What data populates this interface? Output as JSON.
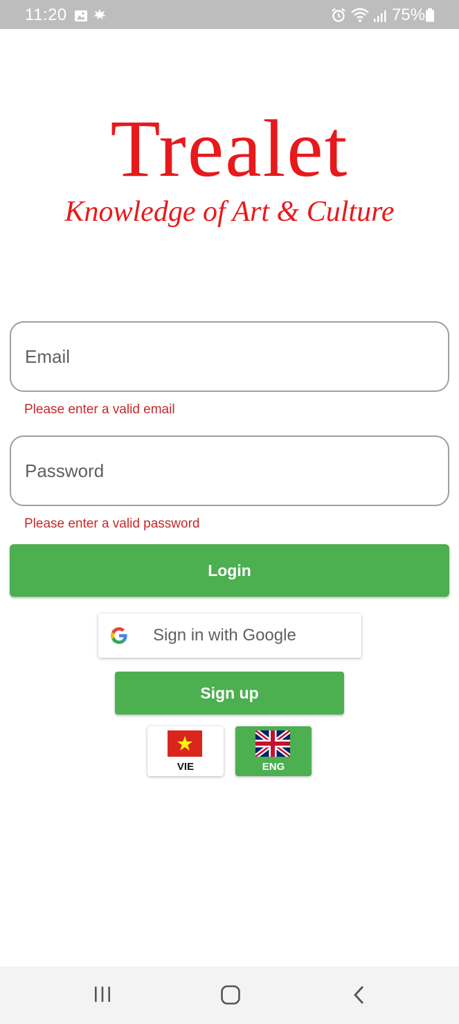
{
  "status_bar": {
    "time": "11:20",
    "battery": "75%",
    "icons": [
      "gallery-icon",
      "leaf-icon",
      "alarm-icon",
      "wifi-icon",
      "signal-icon",
      "battery-icon"
    ]
  },
  "logo": {
    "title": "Trealet",
    "subtitle": "Knowledge of Art & Culture",
    "color": "#e8191c"
  },
  "form": {
    "email_placeholder": "Email",
    "email_error": "Please enter a valid email",
    "password_placeholder": "Password",
    "password_error": "Please enter a valid password",
    "login_label": "Login",
    "google_label": "Sign in with Google",
    "signup_label": "Sign up"
  },
  "languages": [
    {
      "code": "VIE",
      "selected": false
    },
    {
      "code": "ENG",
      "selected": true
    }
  ],
  "colors": {
    "primary_green": "#4caf50",
    "error_red": "#c62828"
  },
  "nav_bar": {
    "icons": [
      "recents-icon",
      "home-icon",
      "back-icon"
    ]
  }
}
